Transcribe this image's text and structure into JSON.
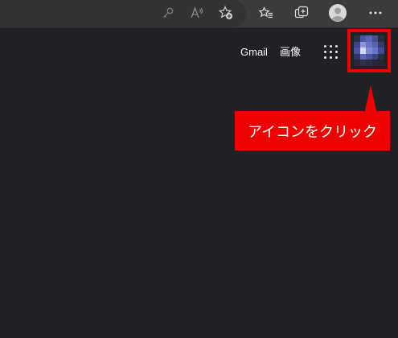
{
  "browser": {
    "icons": [
      "key-icon",
      "read-aloud-icon",
      "add-favorite-icon",
      "favorites-icon",
      "collections-icon",
      "profile-icon",
      "more-icon"
    ]
  },
  "google_header": {
    "gmail_label": "Gmail",
    "images_label": "画像",
    "apps_icon": "apps-grid-icon",
    "account_icon": "account-avatar-icon"
  },
  "annotation": {
    "callout_text": "アイコンをクリック",
    "highlight_color": "#ee0000"
  },
  "colors": {
    "page_background": "#202124",
    "toolbar_background": "#3b3b3b",
    "accent": "#ee0000"
  }
}
